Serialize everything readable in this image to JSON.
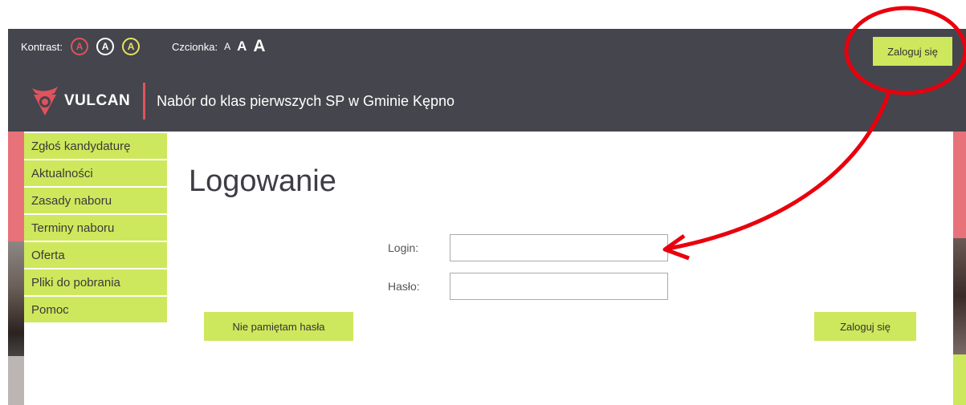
{
  "accessibility": {
    "contrast_label": "Kontrast:",
    "contrast_options": [
      {
        "glyph": "A",
        "color": "#e0535c"
      },
      {
        "glyph": "A",
        "color": "#ffffff"
      },
      {
        "glyph": "A",
        "color": "#e8e25c"
      }
    ],
    "font_label": "Czcionka:",
    "font_options": [
      "A",
      "A",
      "A"
    ]
  },
  "header": {
    "login_button": "Zaloguj się",
    "logo_text": "VULCAN",
    "app_title": "Nabór do klas pierwszych SP w Gminie Kępno"
  },
  "sidebar": {
    "items": [
      {
        "label": "Zgłoś kandydaturę"
      },
      {
        "label": "Aktualności"
      },
      {
        "label": "Zasady naboru"
      },
      {
        "label": "Terminy naboru"
      },
      {
        "label": "Oferta"
      },
      {
        "label": "Pliki do pobrania"
      },
      {
        "label": "Pomoc"
      }
    ]
  },
  "main": {
    "title": "Logowanie",
    "login_label": "Login:",
    "login_value": "",
    "password_label": "Hasło:",
    "password_value": "",
    "forgot_button": "Nie pamiętam hasła",
    "submit_button": "Zaloguj się"
  },
  "colors": {
    "header_bg": "#45454d",
    "accent_green": "#cde85c",
    "brand_red": "#e0535c",
    "annotation_red": "#e8000d"
  }
}
